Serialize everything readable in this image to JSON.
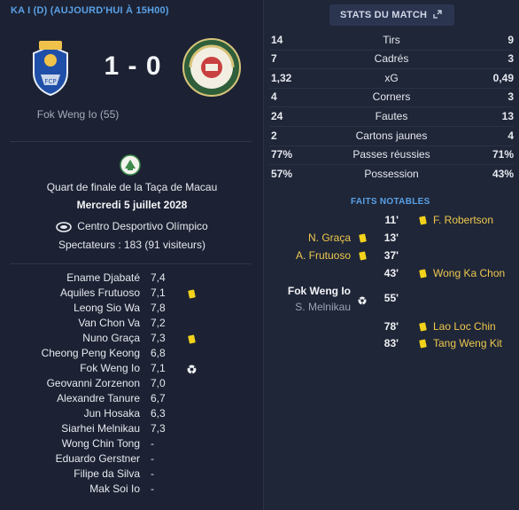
{
  "competition_header": "KA I (D) (AUJOURD'HUI À 15H00)",
  "score": "1 - 0",
  "scorer_line": "Fok Weng Io (55)",
  "match_info": {
    "competition": "Quart de finale de la Taça de Macau",
    "date": "Mercredi 5 juillet 2028",
    "stadium": "Centro Desportivo Olímpico",
    "spectators": "Spectateurs : 183 (91 visiteurs)"
  },
  "ratings": [
    {
      "name": "Ename Djabaté",
      "rating": "7,4",
      "icon": ""
    },
    {
      "name": "Aquiles Frutuoso",
      "rating": "7,1",
      "icon": "yellow-card"
    },
    {
      "name": "Leong Sio Wa",
      "rating": "7,8",
      "icon": ""
    },
    {
      "name": "Van Chon Va",
      "rating": "7,2",
      "icon": ""
    },
    {
      "name": "Nuno Graça",
      "rating": "7,3",
      "icon": "yellow-card"
    },
    {
      "name": "Cheong Peng Keong",
      "rating": "6,8",
      "icon": ""
    },
    {
      "name": "Fok Weng Io",
      "rating": "7,1",
      "icon": "goal-ball"
    },
    {
      "name": "Geovanni Zorzenon",
      "rating": "7,0",
      "icon": ""
    },
    {
      "name": "Alexandre Tanure",
      "rating": "6,7",
      "icon": ""
    },
    {
      "name": "Jun Hosaka",
      "rating": "6,3",
      "icon": ""
    },
    {
      "name": "Siarhei Melnikau",
      "rating": "7,3",
      "icon": ""
    },
    {
      "name": "Wong Chin Tong",
      "rating": "-",
      "icon": ""
    },
    {
      "name": "Eduardo Gerstner",
      "rating": "-",
      "icon": ""
    },
    {
      "name": "Filipe da Silva",
      "rating": "-",
      "icon": ""
    },
    {
      "name": "Mak Soi Io",
      "rating": "-",
      "icon": ""
    }
  ],
  "stats_button_label": "STATS DU MATCH",
  "stats": [
    {
      "home": "14",
      "label": "Tirs",
      "away": "9",
      "bold": "none"
    },
    {
      "home": "7",
      "label": "Cadrés",
      "away": "3",
      "bold": "none"
    },
    {
      "home": "1,32",
      "label": "xG",
      "away": "0,49",
      "bold": "none"
    },
    {
      "home": "4",
      "label": "Corners",
      "away": "3",
      "bold": "none"
    },
    {
      "home": "24",
      "label": "Fautes",
      "away": "13",
      "bold": "none"
    },
    {
      "home": "2",
      "label": "Cartons jaunes",
      "away": "4",
      "bold": "none"
    },
    {
      "home": "77%",
      "label": "Passes réussies",
      "away": "71%",
      "bold": "none"
    },
    {
      "home": "57%",
      "label": "Possession",
      "away": "43%",
      "bold": "none"
    }
  ],
  "faits_title": "FAITS NOTABLES",
  "events": [
    {
      "minute": "11'",
      "home": "",
      "home_sub": "",
      "away": "F. Robertson",
      "type": "away-card"
    },
    {
      "minute": "13'",
      "home": "N. Graça",
      "home_sub": "",
      "away": "",
      "type": "home-card"
    },
    {
      "minute": "37'",
      "home": "A. Frutuoso",
      "home_sub": "",
      "away": "",
      "type": "home-card"
    },
    {
      "minute": "43'",
      "home": "",
      "home_sub": "",
      "away": "Wong Ka Chon",
      "type": "away-card"
    },
    {
      "minute": "55'",
      "home": "Fok Weng Io",
      "home_sub": "S. Melnikau",
      "away": "",
      "type": "home-goal"
    },
    {
      "minute": "78'",
      "home": "",
      "home_sub": "",
      "away": "Lao Loc Chin",
      "type": "away-card"
    },
    {
      "minute": "83'",
      "home": "",
      "home_sub": "",
      "away": "Tang Weng Kit",
      "type": "away-card"
    }
  ],
  "colors": {
    "accent": "#5aa0e6",
    "card": "#f2d21a",
    "event_name": "#eec84c",
    "background": "#1d2436"
  }
}
